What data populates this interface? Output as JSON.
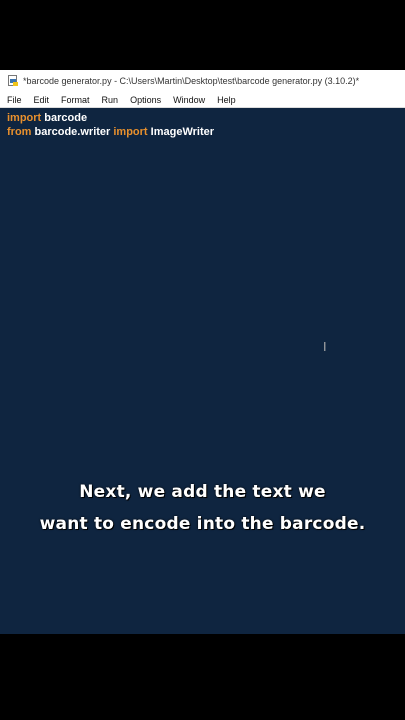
{
  "window": {
    "title": "*barcode generator.py - C:\\Users\\Martin\\Desktop\\test\\barcode generator.py (3.10.2)*"
  },
  "menu": [
    "File",
    "Edit",
    "Format",
    "Run",
    "Options",
    "Window",
    "Help"
  ],
  "code": {
    "line1": {
      "kw": "import",
      "rest": " barcode"
    },
    "line2": {
      "kw1": "from",
      "mid": " barcode.writer ",
      "kw2": "import",
      "rest": " ImageWriter"
    }
  },
  "caption": {
    "line1": "Next, we add the text we",
    "line2": "want to encode into the barcode."
  },
  "colors": {
    "editor_bg": "#0f2540",
    "keyword": "#e8902d",
    "text": "#ffffff"
  },
  "icons": {
    "title": "python-file-icon",
    "cursor": "text-cursor-icon"
  }
}
